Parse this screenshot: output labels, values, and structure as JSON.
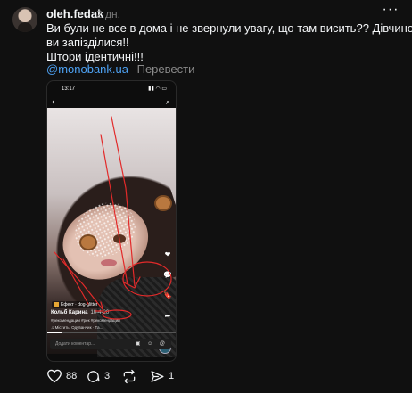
{
  "post": {
    "username": "oleh.fedak",
    "time": "2 дн.",
    "more_label": "···",
    "text_lines": [
      "Ви були не все в дома і не звернули увагу, що там висить?? Дівчино,",
      "ви запізділися!!",
      "Штори ідентичні!!!"
    ],
    "mention": "@monobank.ua",
    "translate_label": "Перевести"
  },
  "embedded_screenshot": {
    "clock": "13:17",
    "status_icons": "▮▮ ◠ ▭",
    "back_icon": "‹",
    "search_icon": "⌕",
    "effect_label": "Ефект · dog-glitter",
    "author_name": "Кольб Карина",
    "date": "10-4-26",
    "hashtags": "#рекомендации #рек #рекомендации",
    "music_label": "♫ Містить: Одуванчик · Та...",
    "progress": 0.12,
    "comment_placeholder": "Додати коментар...",
    "comment_icons": "▣ ☺ @",
    "side_actions": [
      "❤",
      "💬",
      "🔖",
      "➦"
    ],
    "annotation_color": "#e22a2a"
  },
  "actions": {
    "likes": "88",
    "comments": "3",
    "reposts": "",
    "shares": "1"
  },
  "colors": {
    "background": "#101010",
    "text": "#f3f5f7",
    "muted": "#777777",
    "link": "#4ea3f5"
  }
}
